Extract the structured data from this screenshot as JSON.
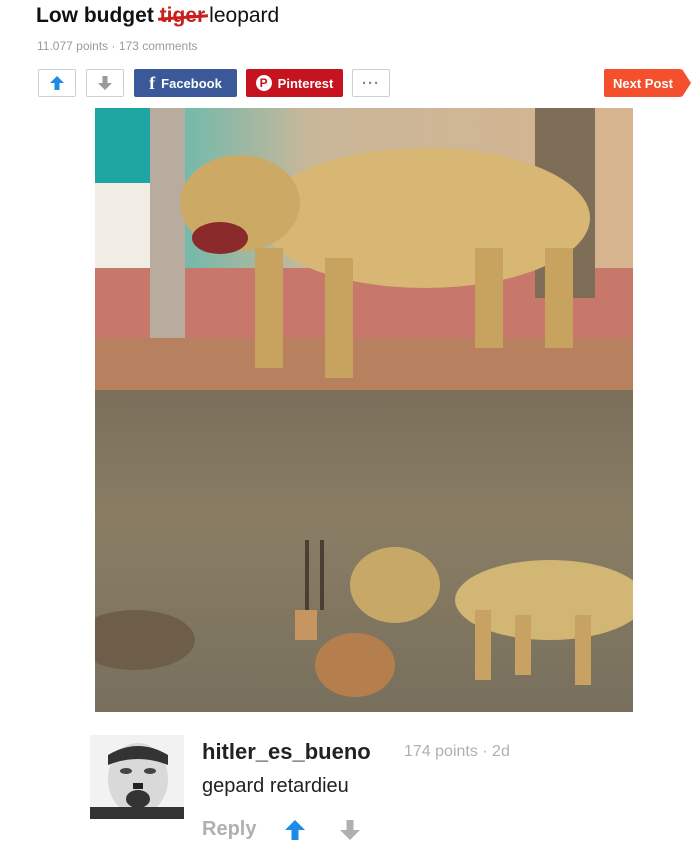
{
  "post": {
    "title_prefix": "Low budget",
    "title_struck": "tiger",
    "title_suffix": "leopard",
    "meta": "11.077 points · 173 comments"
  },
  "actions": {
    "facebook_label": "Facebook",
    "pinterest_label": "Pinterest",
    "more_label": "···",
    "next_label": "Next Post"
  },
  "comment": {
    "username": "hitler_es_bueno",
    "meta": "174 points · 2d",
    "text": "gepard retardieu",
    "reply_label": "Reply"
  },
  "colors": {
    "upvote": "#1d8ae6",
    "facebook": "#3b5998",
    "pinterest": "#c5131f",
    "next": "#f4502d"
  },
  "icons": {
    "upvote": "up-arrow-icon",
    "downvote": "down-arrow-icon",
    "facebook": "facebook-icon",
    "pinterest": "pinterest-icon",
    "more": "ellipsis-icon"
  }
}
